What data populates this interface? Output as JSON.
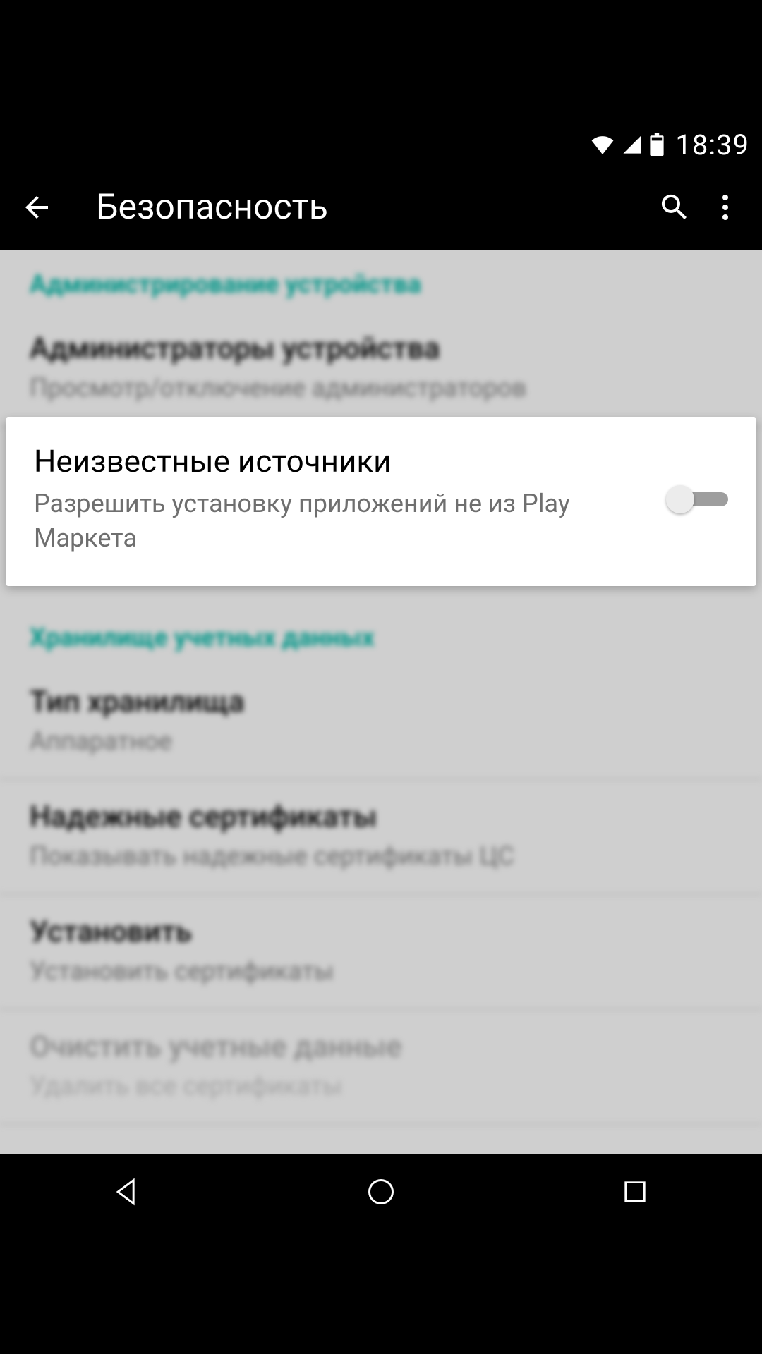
{
  "statusbar": {
    "time": "18:39"
  },
  "appbar": {
    "title": "Безопасность"
  },
  "sections": {
    "admin": {
      "header": "Администрирование устройства",
      "items": [
        {
          "title": "Администраторы устройства",
          "sub": "Просмотр/отключение администраторов"
        }
      ]
    },
    "unknown": {
      "title": "Неизвестные источники",
      "sub": "Разрешить установку приложений не из Play Маркета",
      "enabled": false
    },
    "creds": {
      "header": "Хранилище учетных данных",
      "items": [
        {
          "title": "Тип хранилища",
          "sub": "Аппаратное"
        },
        {
          "title": "Надежные сертификаты",
          "sub": "Показывать надежные сертификаты ЦС"
        },
        {
          "title": "Установить",
          "sub": "Установить сертификаты"
        },
        {
          "title": "Очистить учетные данные",
          "sub": "Удалить все сертификаты",
          "disabled": true
        }
      ]
    }
  }
}
